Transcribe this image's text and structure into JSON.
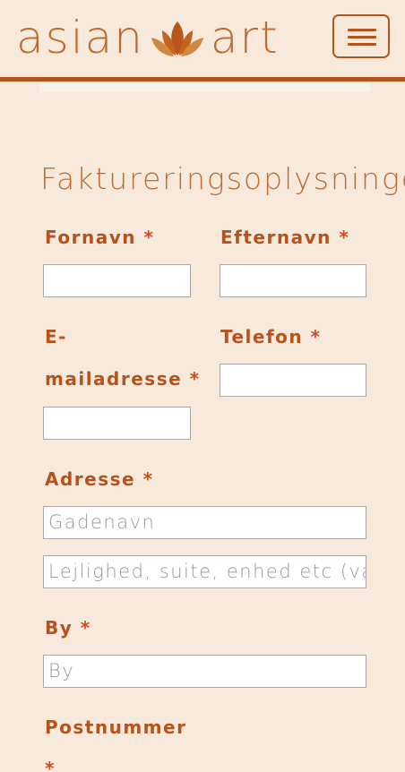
{
  "header": {
    "brand_left": "asian",
    "brand_right": "art",
    "brand_colors": {
      "lotus": "#b8561b",
      "text": "#c06a2f"
    },
    "menu_icon": "hamburger-icon"
  },
  "form": {
    "section_title": "Faktureringsoplysninger",
    "required_mark": "*",
    "fields": {
      "first_name": {
        "label": "Fornavn",
        "value": ""
      },
      "last_name": {
        "label": "Efternavn",
        "value": ""
      },
      "email": {
        "label_line1": "E-",
        "label_line2": "mailadresse",
        "value": ""
      },
      "phone": {
        "label": "Telefon",
        "value": ""
      },
      "address": {
        "label": "Adresse",
        "street_placeholder": "Gadenavn",
        "apartment_placeholder": "Lejlighed, suite, enhed etc (va"
      },
      "city": {
        "label": "By",
        "placeholder": "By"
      },
      "postcode": {
        "label": "Postnummer"
      }
    }
  },
  "colors": {
    "background": "#f7eadc",
    "accent": "#b6531c",
    "label": "#b5531a",
    "required": "#d14b1d"
  }
}
